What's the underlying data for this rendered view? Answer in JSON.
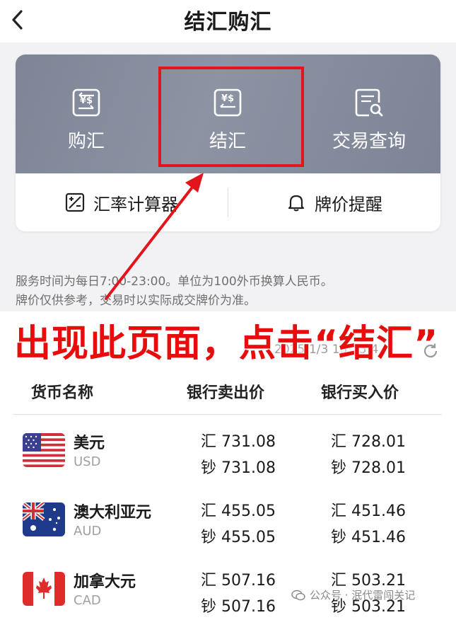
{
  "header": {
    "title": "结汇购汇"
  },
  "actions": [
    {
      "label": "购汇",
      "icon": "exchange-icon"
    },
    {
      "label": "结汇",
      "icon": "exchange-reverse-icon"
    },
    {
      "label": "交易查询",
      "icon": "document-search-icon"
    }
  ],
  "tools": [
    {
      "label": "汇率计算器",
      "icon": "calculator-icon"
    },
    {
      "label": "牌价提醒",
      "icon": "bell-icon"
    }
  ],
  "notice": {
    "line1": "服务时间为每日7:00-23:00。单位为100外币换算人民币。",
    "line2": "牌价仅供参考，交易时以实际成交牌价为准。"
  },
  "overlay": {
    "text": "出现此页面，点击“结汇”"
  },
  "update_time": "2025/1/3 15:25:4",
  "table": {
    "headers": [
      "货币名称",
      "银行卖出价",
      "银行买入价"
    ],
    "rows": [
      {
        "name": "美元",
        "code": "USD",
        "sell_remit": "汇 731.08",
        "sell_cash": "钞 731.08",
        "buy_remit": "汇 728.01",
        "buy_cash": "钞 728.01",
        "flag": "us-flag-icon"
      },
      {
        "name": "澳大利亚元",
        "code": "AUD",
        "sell_remit": "汇 455.05",
        "sell_cash": "钞 455.05",
        "buy_remit": "汇 451.46",
        "buy_cash": "钞 451.46",
        "flag": "au-flag-icon"
      },
      {
        "name": "加拿大元",
        "code": "CAD",
        "sell_remit": "汇 507.16",
        "sell_cash": "钞 507.16",
        "buy_remit": "汇 503.21",
        "buy_cash": "钞 503.21",
        "flag": "ca-flag-icon"
      }
    ]
  },
  "watermark": "公众号 · 泯代雷闯关记",
  "colors": {
    "highlight": "#e3141b",
    "overlay_text": "#e80d0d",
    "card_bg": "#858c9c"
  }
}
